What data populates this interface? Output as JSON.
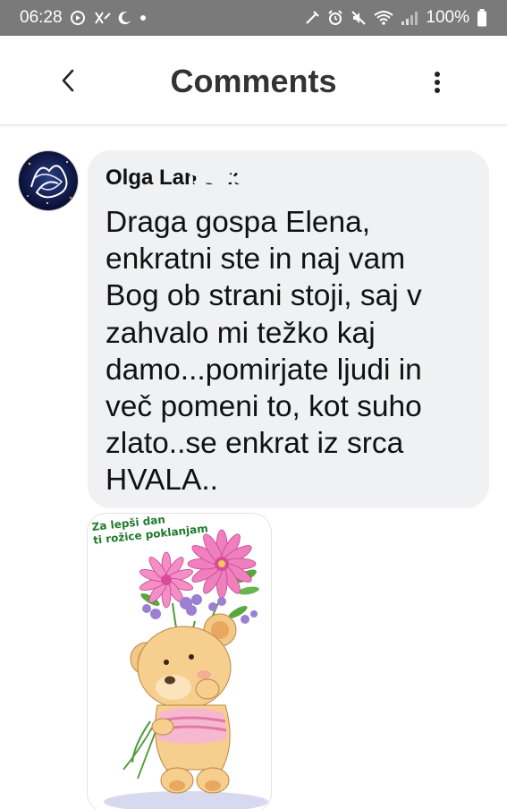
{
  "status_bar": {
    "time": "06:28",
    "battery": "100%",
    "left_icons": [
      "dnd-icon",
      "cross-icon",
      "moon-icon",
      "dot-icon"
    ],
    "right_icons": [
      "nfc-icon",
      "alarm-icon",
      "mute-icon",
      "wifi-icon",
      "signal-icon",
      "battery-icon"
    ]
  },
  "header": {
    "title": "Comments",
    "back_icon": "chevron-left-icon",
    "more_icon": "more-vertical-icon"
  },
  "comment": {
    "author": "Olga Lanisek",
    "text": "Draga gospa Elena,\nenkratni ste in naj vam\nBog ob strani stoji, saj v\nzahvalo mi težko kaj\ndamo...pomirjate ljudi in\nveč pomeni to, kot suho\nzlato..se enkrat iz srca\nHVALA.."
  },
  "sticker": {
    "caption_line1": "Za lepši dan",
    "caption_line2": "ti rožice poklanjam"
  },
  "colors": {
    "status_bar": "#7a7a7a",
    "bubble": "#f0f1f3",
    "caption": "#1f7a2c"
  }
}
